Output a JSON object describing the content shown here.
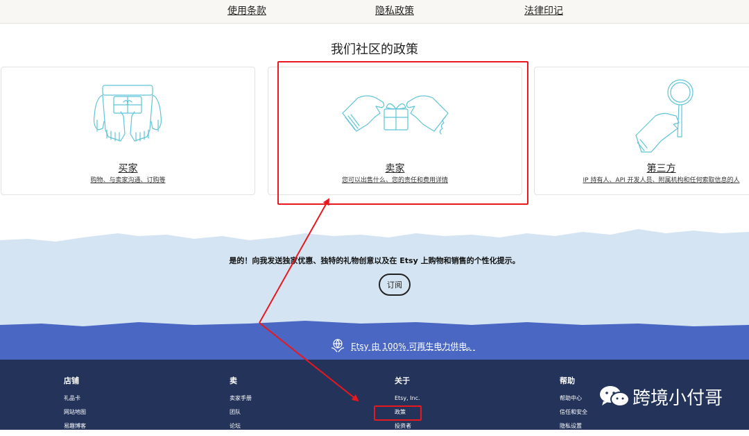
{
  "top_nav": {
    "links": [
      "使用条款",
      "隐私政策",
      "法律印记"
    ]
  },
  "policies": {
    "title": "我们社区的政策",
    "cards": [
      {
        "title": "买家",
        "desc": "购物、与卖家沟通、订购等"
      },
      {
        "title": "卖家",
        "desc": "您可以出售什么、您的责任和费用详情"
      },
      {
        "title": "第三方",
        "desc": "IP 持有人、API 开发人员、附属机构和任何索取信息的人"
      }
    ]
  },
  "newsletter": {
    "text": "是的！向我发送独家优惠、独特的礼物创意以及在 Etsy 上购物和销售的个性化提示。",
    "button_label": "订阅"
  },
  "energy": {
    "text": "Etsy 由 100% 可再生电力供电。"
  },
  "footer": {
    "columns": [
      {
        "title": "店铺",
        "links": [
          "礼品卡",
          "网站地图",
          "易趣博客"
        ]
      },
      {
        "title": "卖",
        "links": [
          "卖家手册",
          "团队",
          "论坛"
        ]
      },
      {
        "title": "关于",
        "links": [
          "Etsy, Inc.",
          "政策",
          "投资者"
        ]
      },
      {
        "title": "帮助",
        "links": [
          "帮助中心",
          "信任和安全",
          "隐私设置"
        ]
      }
    ]
  },
  "watermark": {
    "text": "跨境小付哥",
    "icon": "wechat-icon"
  },
  "colors": {
    "annotation_red": "#e8181e",
    "illustration_teal": "#5ec4d6",
    "newsletter_bg": "#d4e4f2",
    "energy_bg": "#4a67c3",
    "footer_bg": "#24335a"
  }
}
